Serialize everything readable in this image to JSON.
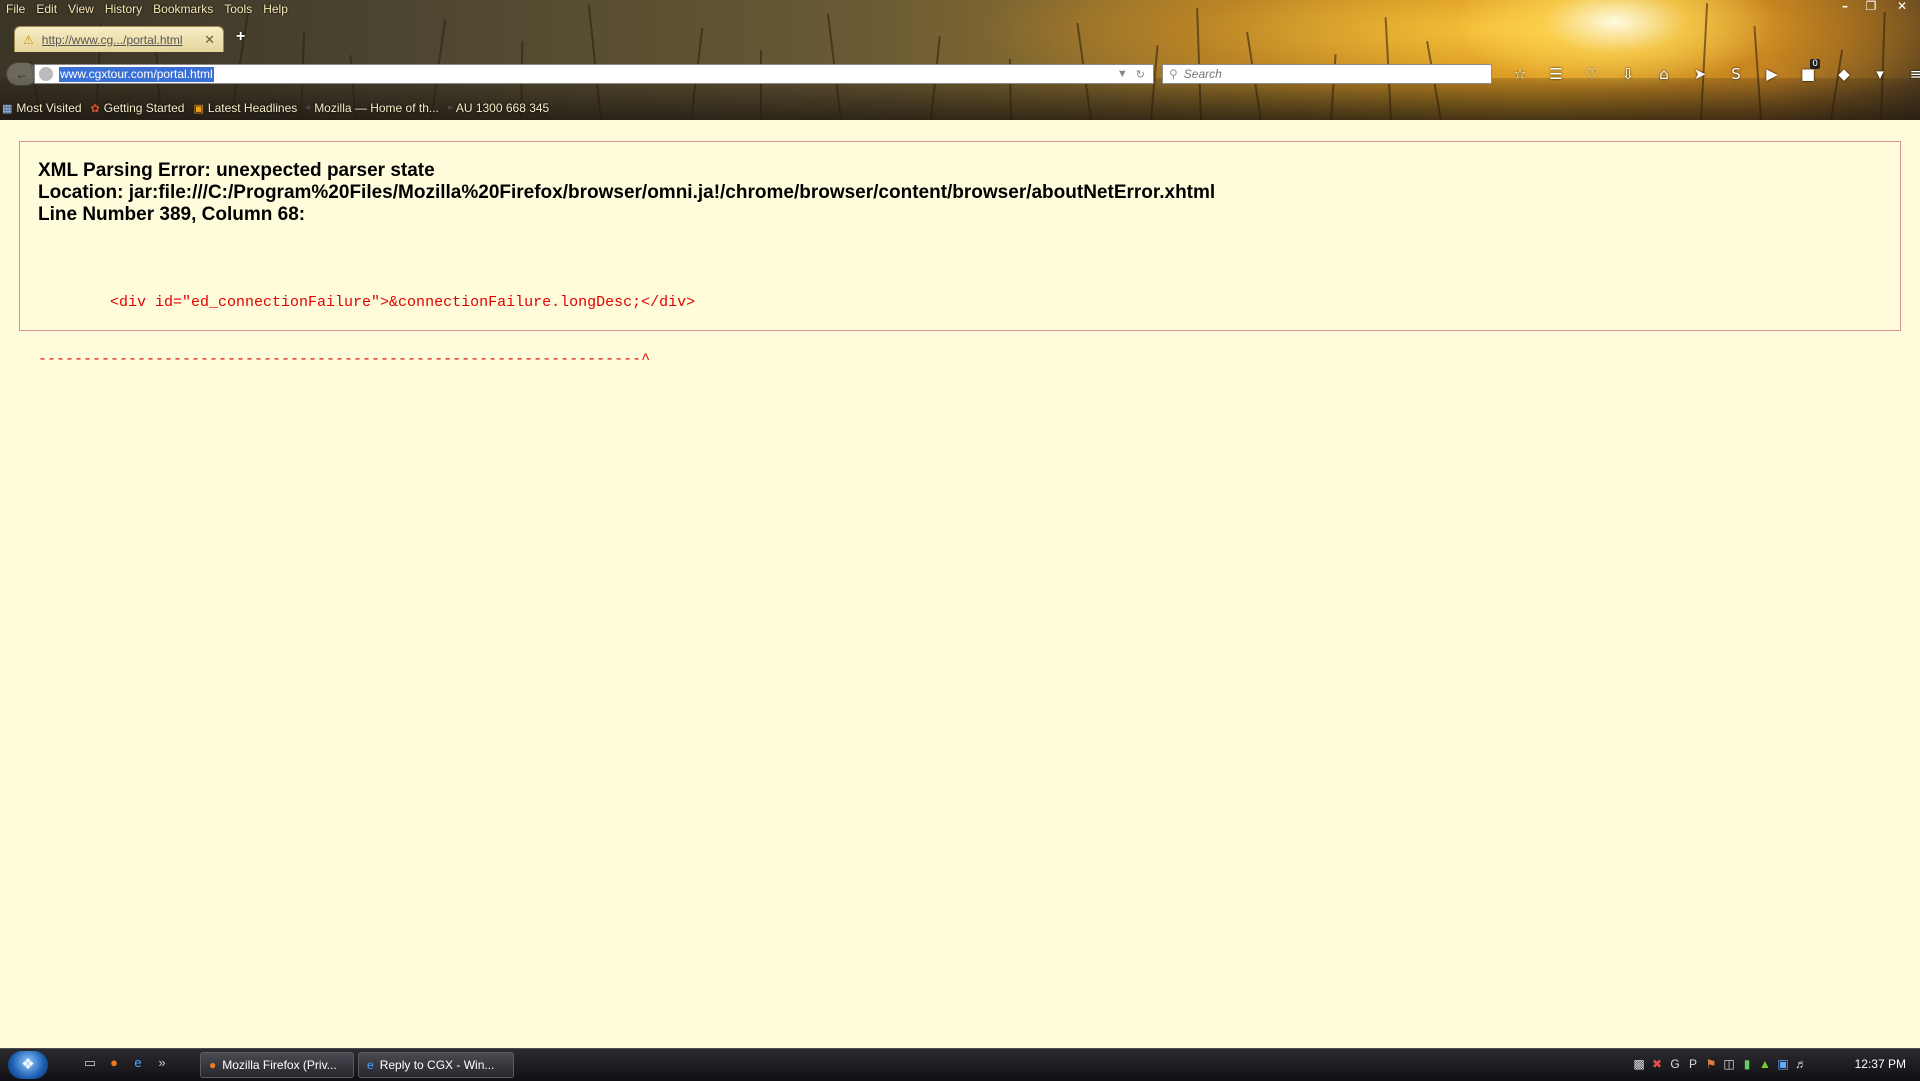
{
  "browser": {
    "menu": [
      "File",
      "Edit",
      "View",
      "History",
      "Bookmarks",
      "Tools",
      "Help"
    ],
    "tab_title": "http://www.cg.../portal.html",
    "new_tab_label": "+",
    "url": "www.cgxtour.com/portal.html",
    "search_placeholder": "Search",
    "download_badge": "0",
    "bookmarks": [
      "Most Visited",
      "Getting Started",
      "Latest Headlines",
      "Mozilla — Home of th...",
      "AU  1300 668 345"
    ]
  },
  "error": {
    "title": "XML Parsing Error: unexpected parser state",
    "location": "Location: jar:file:///C:/Program%20Files/Mozilla%20Firefox/browser/omni.ja!/chrome/browser/content/browser/aboutNetError.xhtml",
    "line": "Line Number 389, Column 68:",
    "source_line": "        <div id=\"ed_connectionFailure\">&connectionFailure.longDesc;</div>",
    "pointer_line": "-------------------------------------------------------------------^"
  },
  "taskbar": {
    "tasks": [
      "Mozilla Firefox (Priv...",
      "Reply to CGX - Win..."
    ],
    "clock": "12:37 PM"
  }
}
